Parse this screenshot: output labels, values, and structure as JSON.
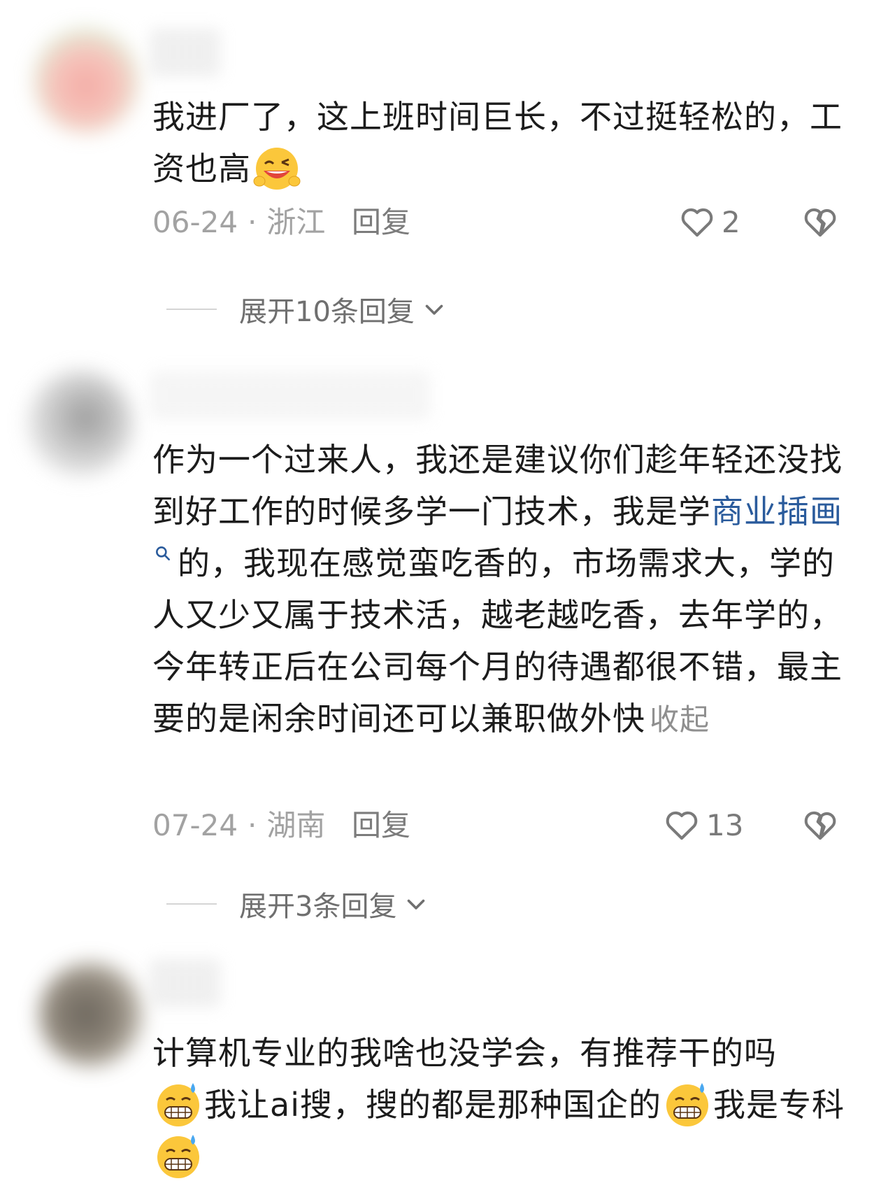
{
  "comments": [
    {
      "text": "我进厂了，这上班时间巨长，不过挺轻松的，工资也高",
      "date": "06-24",
      "location": "浙江",
      "reply_label": "回复",
      "likes": "2",
      "expand_label": "展开10条回复",
      "emoji": "grinning-wink-emoji"
    },
    {
      "text_before": "作为一个过来人，我还是建议你们趁年轻还没找到好工作的时候多学一门技术，我是学",
      "link_text": "商业插画",
      "text_after": "的，我现在感觉蛮吃香的，市场需求大，学的人又少又属于技术活，越老越吃香，去年学的，今年转正后在公司每个月的待遇都很不错，最主要的是闲余时间还可以兼职做外快",
      "collapse_label": "收起",
      "date": "07-24",
      "location": "湖南",
      "reply_label": "回复",
      "likes": "13",
      "expand_label": "展开3条回复"
    },
    {
      "text_part1": "计算机专业的我啥也没学会，有推荐干的吗",
      "text_part2": "我让ai搜，搜的都是那种国企的",
      "text_part3": "我是专科",
      "emoji": "sweat-grin-emoji"
    }
  ],
  "colors": {
    "link": "#2a5b9c",
    "meta": "#a2a2a2",
    "text": "#1c1c1c"
  }
}
